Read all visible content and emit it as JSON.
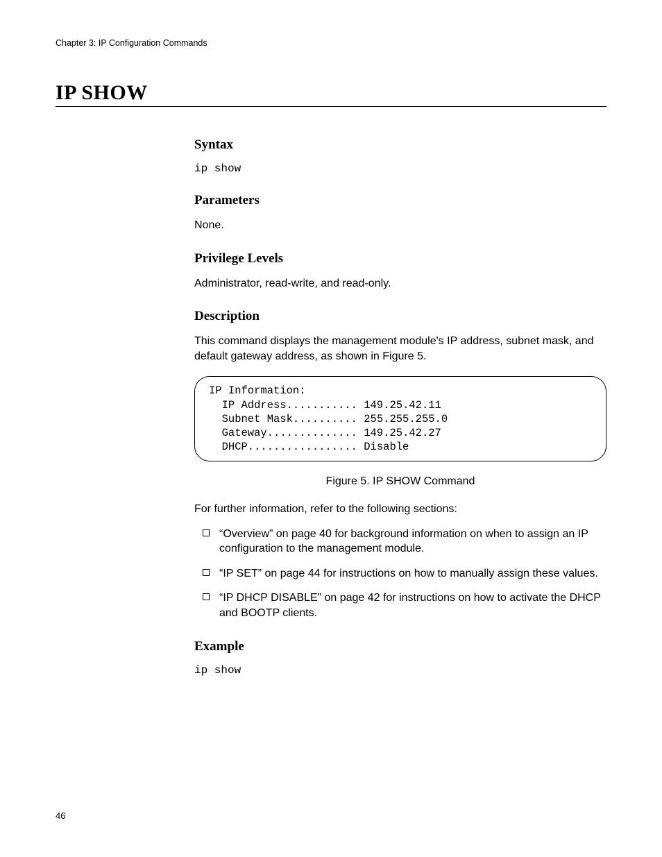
{
  "running_header": "Chapter 3: IP Configuration Commands",
  "page_title": "IP SHOW",
  "syntax": {
    "heading": "Syntax",
    "code": "ip show"
  },
  "parameters": {
    "heading": "Parameters",
    "text": "None."
  },
  "privilege": {
    "heading": "Privilege Levels",
    "text": "Administrator, read-write, and read-only."
  },
  "description": {
    "heading": "Description",
    "text": "This command displays the management module's IP address, subnet mask, and default gateway address, as shown in Figure 5."
  },
  "code_block": "IP Information:\n  IP Address........... 149.25.42.11\n  Subnet Mask.......... 255.255.255.0\n  Gateway.............. 149.25.42.27\n  DHCP................. Disable",
  "figure_caption": "Figure 5. IP SHOW Command",
  "further_info_intro": "For further information, refer to the following sections:",
  "bullets": [
    "“Overview” on page 40 for background information on when to assign an IP configuration to the management module.",
    "“IP SET” on page 44 for instructions on how to manually assign these values.",
    "“IP DHCP DISABLE” on page 42 for instructions on how to activate the DHCP and BOOTP clients."
  ],
  "example": {
    "heading": "Example",
    "code": "ip show"
  },
  "page_number": "46"
}
